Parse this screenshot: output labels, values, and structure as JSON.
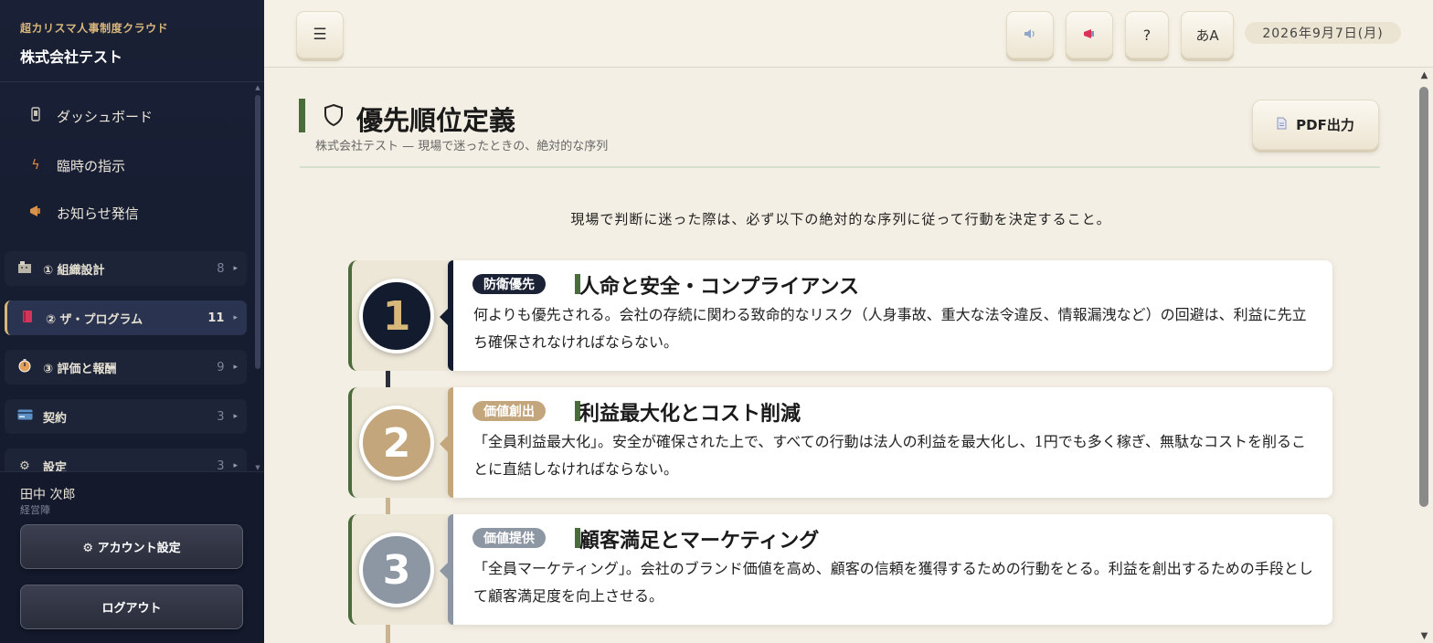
{
  "sidebar": {
    "app_name": "超カリスマ人事制度クラウド",
    "company": "株式会社テスト",
    "top_items": [
      {
        "label": "ダッシュボード",
        "icon": "phone-icon"
      },
      {
        "label": "臨時の指示",
        "icon": "lightning-icon"
      },
      {
        "label": "お知らせ発信",
        "icon": "megaphone-icon"
      }
    ],
    "groups": [
      {
        "label": "① 組織設計",
        "count": "8",
        "icon": "building-icon"
      },
      {
        "label": "② ザ・プログラム",
        "count": "11",
        "icon": "book-icon",
        "active": true
      },
      {
        "label": "③ 評価と報酬",
        "count": "9",
        "icon": "stopwatch-icon"
      },
      {
        "label": "契約",
        "count": "3",
        "icon": "card-icon"
      },
      {
        "label": "設定",
        "count": "3",
        "icon": "gear-icon"
      }
    ],
    "user": {
      "name": "田中 次郎",
      "role": "経営陣"
    },
    "account_button": "⚙ アカウント設定",
    "logout_button": "ログアウト"
  },
  "header": {
    "menu_icon": "☰",
    "help_label": "?",
    "font_label": "あA",
    "date": "2026年9月7日(月)"
  },
  "page": {
    "title": "優先順位定義",
    "subtitle": "株式会社テスト — 現場で迷ったときの、絶対的な序列",
    "pdf_label": "PDF出力",
    "intro": "現場で判断に迷った際は、必ず以下の絶対的な序列に従って行動を決定すること。"
  },
  "priorities": [
    {
      "number": "1",
      "tag": "防衛優先",
      "title": "人命と安全・コンプライアンス",
      "description": "何よりも優先される。会社の存続に関わる致命的なリスク（人身事故、重大な法令違反、情報漏洩など）の回避は、利益に先立ち確保されなければならない。",
      "color": "#131b2e",
      "num_color": "#d8b77a"
    },
    {
      "number": "2",
      "tag": "価値創出",
      "title": "利益最大化とコスト削減",
      "description": "「全員利益最大化」。安全が確保された上で、すべての行動は法人の利益を最大化し、1円でも多く稼ぎ、無駄なコストを削ることに直結しなければならない。",
      "color": "#c4a67c",
      "num_color": "#ffffff"
    },
    {
      "number": "3",
      "tag": "価値提供",
      "title": "顧客満足とマーケティング",
      "description": "「全員マーケティング」。会社のブランド価値を高め、顧客の信頼を獲得するための行動をとる。利益を創出するための手段として顧客満足度を向上させる。",
      "color": "#8d97a3",
      "num_color": "#ffffff"
    }
  ]
}
